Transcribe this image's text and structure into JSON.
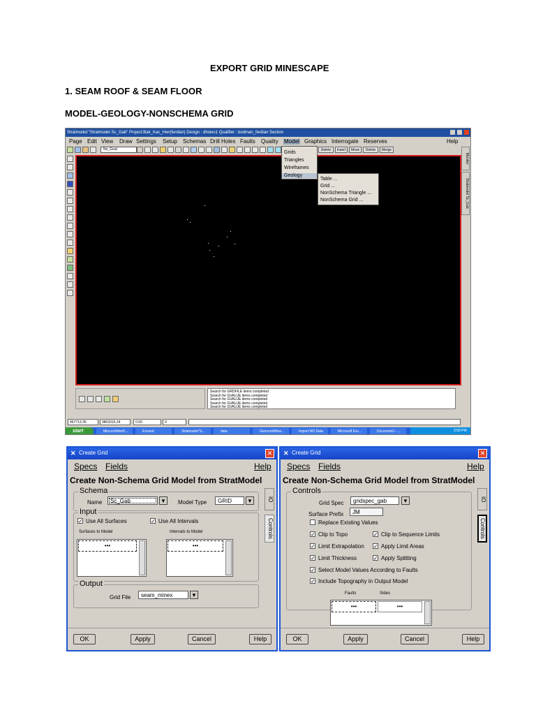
{
  "document": {
    "title": "EXPORT GRID MINESCAPE",
    "section": "1.   SEAM ROOF & SEAM FLOOR",
    "subsection": "MODEL-GEOLOGY-NONSCHEMA GRID"
  },
  "app": {
    "title": "Stratmodel:\"Stratmodel Sc_Gab\"      Project:Bak_Kac_Hwr(ferdian)   Design : dholes1    Qualifier : bodman_ferdian    Section",
    "menu": [
      "Page",
      "Edit",
      "View",
      "Draw",
      "Settings",
      "Setup",
      "Schemas",
      "Drill Holes",
      "Faults",
      "Quality",
      "Model",
      "Graphics",
      "Interrogate",
      "Reserves"
    ],
    "help": "Help",
    "toolbar_combo": "No_Goal",
    "model_menu": [
      "Grids",
      "Triangles",
      "Wireframes",
      "Geology"
    ],
    "geology_submenu": [
      "Table ...",
      "Grid ...",
      "NonSchema Triangle ...",
      "NonSchema Grid ..."
    ],
    "edit_buttons": [
      "Delete",
      "Insert",
      "Move",
      "Delete",
      "Merge"
    ],
    "side_tabs": [
      "Monitor",
      "Stratmodel Sc_Gab"
    ],
    "status_lines": [
      "Search for GRDFILE items completed",
      "Search for GVALUE items completed",
      "Search for GVALUE items completed",
      "Search for GVALUE items completed",
      "Search for GVALUE items completed"
    ],
    "statusbar": [
      "457713.35",
      "9803315.24",
      "0.00",
      "0"
    ],
    "taskbar": {
      "start": "start",
      "tasks": [
        "MincomMine5...",
        "Exceed",
        "Stratmodel\"S...",
        "data",
        "Gencom/Mine...",
        "Import W2 Data",
        "Microsoft Exc...",
        "Document1 - ..."
      ],
      "clock": "3:58 PM"
    }
  },
  "dialog_left": {
    "title": "Create Grid",
    "menu": [
      "Specs",
      "Fields"
    ],
    "help": "Help",
    "heading": "Create Non-Schema Grid Model from StratModel",
    "schema_label": "Schema",
    "name_label": "Name",
    "name_value": "Sc_Gab",
    "model_type_label": "Model Type",
    "model_type_value": "GRID",
    "input_label": "Input",
    "use_all_surfaces": "Use All Surfaces",
    "use_all_intervals": "Use All Intervals",
    "surfaces_label": "Surfaces to Model",
    "intervals_label": "Intervals to Model",
    "cell": "•••",
    "output_label": "Output",
    "grid_file_label": "Grid File",
    "grid_file_value": "seam_minex",
    "tabs": [
      "IO",
      "Controls"
    ],
    "buttons": [
      "OK",
      "Apply",
      "Cancel",
      "Help"
    ]
  },
  "dialog_right": {
    "title": "Create Grid",
    "menu": [
      "Specs",
      "Fields"
    ],
    "help": "Help",
    "heading": "Create Non-Schema Grid Model from StratModel",
    "controls_label": "Controls",
    "grid_spec_label": "Grid Spec",
    "grid_spec_value": "gridspec_gab",
    "surface_prefix_label": "Surface Prefix",
    "surface_prefix_value": "JM",
    "options": {
      "replace": "Replace Existing Values",
      "clip_topo": "Clip to Topo",
      "clip_seq": "Clip to Sequence Limits",
      "limit_extrap": "Limit Extrapolation",
      "apply_limit": "Apply Limit Areas",
      "limit_thick": "Limit Thickness",
      "apply_split": "Apply Splitting",
      "select_faults": "Select Model Values According to Faults",
      "include_topo": "Include Topography in Output Model"
    },
    "faults_label": "Faults",
    "sides_label": "Sides",
    "cell": "•••",
    "tabs": [
      "IO",
      "Controls"
    ],
    "buttons": [
      "OK",
      "Apply",
      "Cancel",
      "Help"
    ]
  }
}
